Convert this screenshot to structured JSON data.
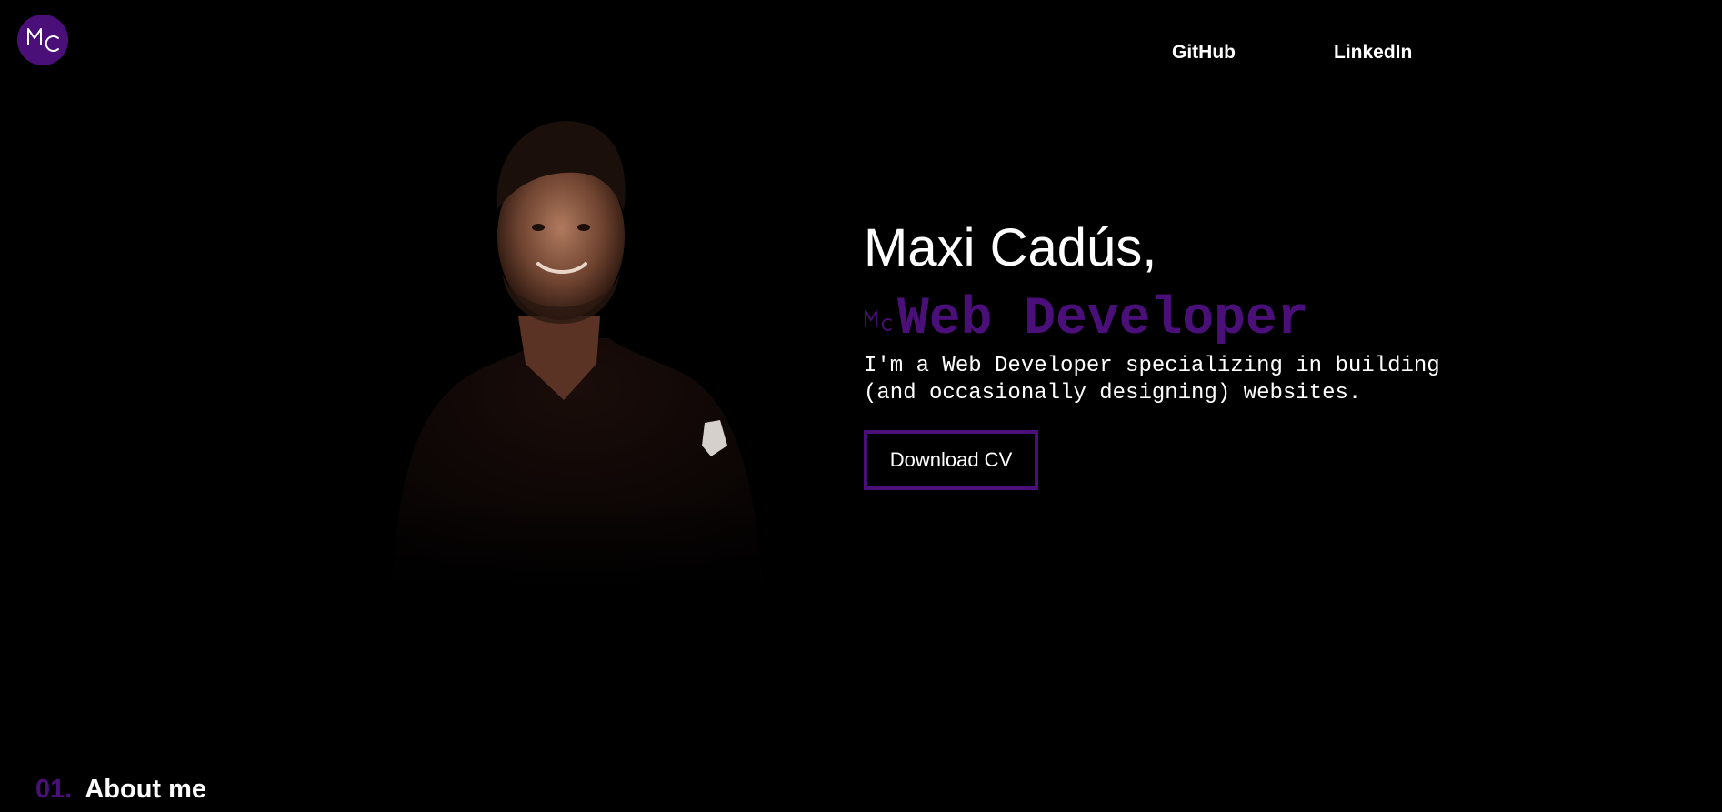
{
  "brand": {
    "logo_text": "MC",
    "accent_color": "#4b0f7a"
  },
  "nav": {
    "links": [
      {
        "label": "GitHub"
      },
      {
        "label": "LinkedIn"
      }
    ]
  },
  "hero": {
    "name": "Maxi Cadús,",
    "role_mark": "MC",
    "role": "Web Developer",
    "description": "I'm a Web Developer specializing in building (and occasionally designing) websites.",
    "cta_label": "Download CV",
    "portrait_icon": "portrait-photo"
  },
  "sections": [
    {
      "number": "01.",
      "title": "About me"
    }
  ]
}
